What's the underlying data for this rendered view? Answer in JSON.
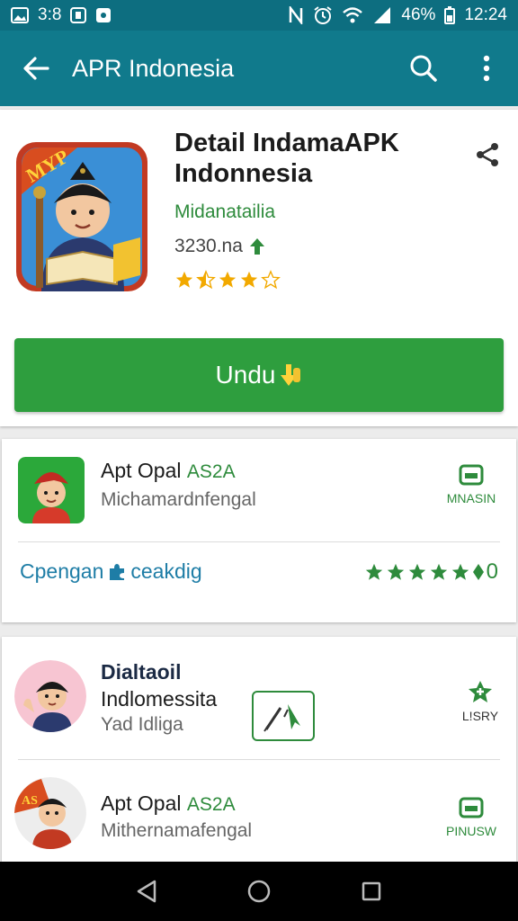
{
  "status_bar": {
    "left_text": "3:8",
    "battery": "46%",
    "time": "12:24"
  },
  "app_bar": {
    "title": "APR Indonesia"
  },
  "detail": {
    "title": "Detail IndamaAPK Indonnesia",
    "developer": "Midanatailia",
    "size": "3230.na",
    "rating_stars": 3,
    "icon_badge": "MYP",
    "install_label": "Undu"
  },
  "card2": {
    "name": "Apt Opal",
    "version": "AS2A",
    "subtitle": "Michamardnfengal",
    "action_label": "MNASIN",
    "category_link": "Cpengan",
    "category_link2": "ceakdig",
    "rating_stars": 5,
    "rating_value": "0"
  },
  "card3": {
    "item1": {
      "title_line1": "Dialtaoil",
      "title_line2": "Indlomessita",
      "subtitle": "Yad Idliga",
      "action_label": "L!SRY"
    },
    "item2": {
      "name": "Apt Opal",
      "version": "AS2A",
      "subtitle": "Mithernamafengal",
      "action_label": "PINUSW",
      "icon_badge": "AS"
    }
  },
  "colors": {
    "primary": "#107a8c",
    "status_bar": "#0d6e80",
    "accent_green": "#2e9e3e",
    "link_blue": "#1e7da6",
    "star_gold": "#f2a900"
  }
}
